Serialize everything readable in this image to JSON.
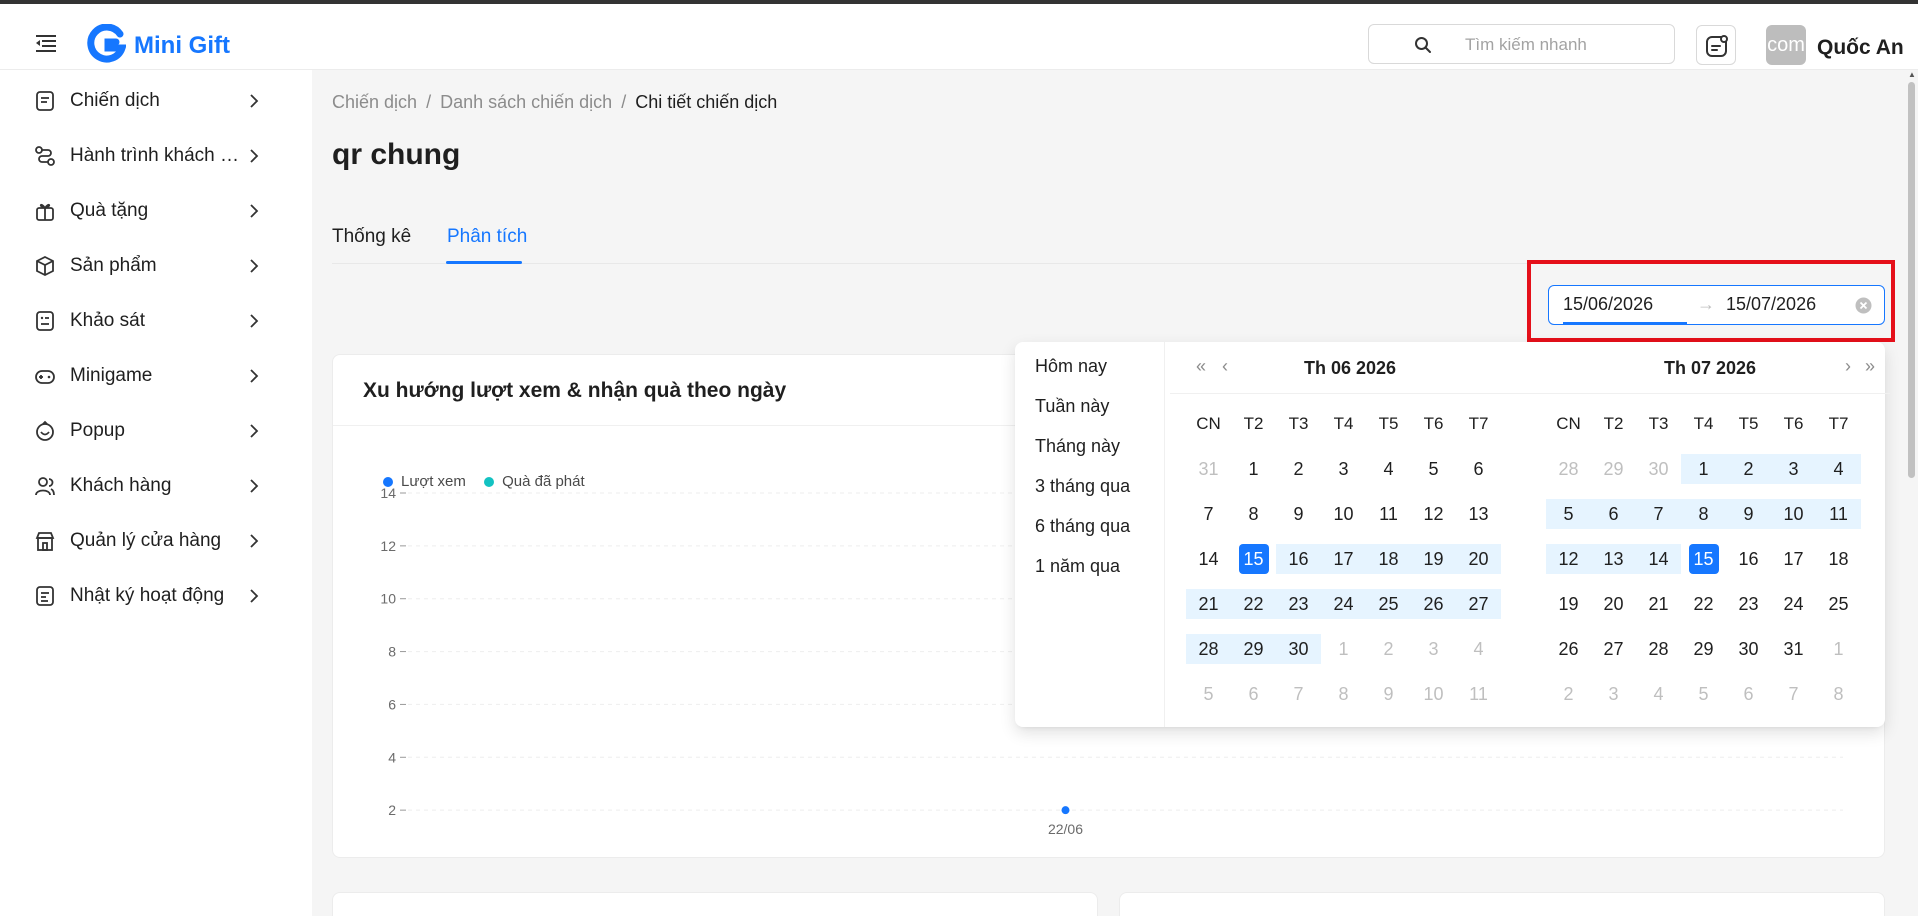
{
  "app": {
    "name": "Mini Gift",
    "brand_color": "#1677ff"
  },
  "header": {
    "search_placeholder": "Tìm kiếm nhanh",
    "avatar_text": "com",
    "user_name": "Quốc An"
  },
  "sidebar": {
    "items": [
      {
        "label": "Chiến dịch",
        "icon": "campaign-icon"
      },
      {
        "label": "Hành trình khách hàng",
        "icon": "journey-icon"
      },
      {
        "label": "Quà tặng",
        "icon": "gift-icon"
      },
      {
        "label": "Sản phẩm",
        "icon": "product-box-icon"
      },
      {
        "label": "Khảo sát",
        "icon": "survey-icon"
      },
      {
        "label": "Minigame",
        "icon": "gamepad-icon"
      },
      {
        "label": "Popup",
        "icon": "popup-icon"
      },
      {
        "label": "Khách hàng",
        "icon": "customers-icon"
      },
      {
        "label": "Quản lý cửa hàng",
        "icon": "store-icon"
      },
      {
        "label": "Nhật ký hoạt động",
        "icon": "activity-log-icon"
      }
    ]
  },
  "breadcrumb": {
    "items": [
      "Chiến dịch",
      "Danh sách chiến dịch",
      "Chi tiết chiến dịch"
    ],
    "separator": "/"
  },
  "page": {
    "title": "qr chung"
  },
  "tabs": [
    {
      "label": "Thống kê",
      "active": false
    },
    {
      "label": "Phân tích",
      "active": true
    }
  ],
  "range_picker": {
    "start": "15/06/2026",
    "end": "15/07/2026",
    "separator": "→"
  },
  "chart_card": {
    "title": "Xu hướng lượt xem & nhận quà theo ngày"
  },
  "chart_data": {
    "type": "line",
    "title": "",
    "xlabel": "",
    "ylabel": "",
    "ylim": [
      0,
      14
    ],
    "yticks": [
      14,
      12,
      10,
      8,
      6,
      4,
      2
    ],
    "x": [
      "22/06"
    ],
    "series": [
      {
        "name": "Lượt xem",
        "color": "#1677ff",
        "values": [
          2
        ]
      },
      {
        "name": "Quà đã phát",
        "color": "#13c2c2",
        "values": []
      }
    ],
    "grid": true,
    "legend": "top-left"
  },
  "date_popup": {
    "presets": [
      "Hôm nay",
      "Tuần này",
      "Tháng này",
      "3 tháng qua",
      "6 tháng qua",
      "1 năm qua"
    ],
    "weekdays": [
      "CN",
      "T2",
      "T3",
      "T4",
      "T5",
      "T6",
      "T7"
    ],
    "months": [
      {
        "title": "Th 06  2026",
        "rows": [
          [
            "31",
            "1",
            "2",
            "3",
            "4",
            "5",
            "6"
          ],
          [
            "7",
            "8",
            "9",
            "10",
            "11",
            "12",
            "13"
          ],
          [
            "14",
            "15",
            "16",
            "17",
            "18",
            "19",
            "20"
          ],
          [
            "21",
            "22",
            "23",
            "24",
            "25",
            "26",
            "27"
          ],
          [
            "28",
            "29",
            "30",
            "1",
            "2",
            "3",
            "4"
          ],
          [
            "5",
            "6",
            "7",
            "8",
            "9",
            "10",
            "11"
          ]
        ],
        "muted": [
          [
            0,
            0
          ],
          [
            4,
            3
          ],
          [
            4,
            4
          ],
          [
            4,
            5
          ],
          [
            4,
            6
          ],
          [
            5,
            0
          ],
          [
            5,
            1
          ],
          [
            5,
            2
          ],
          [
            5,
            3
          ],
          [
            5,
            4
          ],
          [
            5,
            5
          ],
          [
            5,
            6
          ]
        ],
        "selected": [
          [
            2,
            1
          ]
        ],
        "in_range": [
          [
            2,
            2
          ],
          [
            2,
            3
          ],
          [
            2,
            4
          ],
          [
            2,
            5
          ],
          [
            2,
            6
          ],
          [
            3,
            0
          ],
          [
            3,
            1
          ],
          [
            3,
            2
          ],
          [
            3,
            3
          ],
          [
            3,
            4
          ],
          [
            3,
            5
          ],
          [
            3,
            6
          ],
          [
            4,
            0
          ],
          [
            4,
            1
          ],
          [
            4,
            2
          ]
        ]
      },
      {
        "title": "Th 07  2026",
        "rows": [
          [
            "28",
            "29",
            "30",
            "1",
            "2",
            "3",
            "4"
          ],
          [
            "5",
            "6",
            "7",
            "8",
            "9",
            "10",
            "11"
          ],
          [
            "12",
            "13",
            "14",
            "15",
            "16",
            "17",
            "18"
          ],
          [
            "19",
            "20",
            "21",
            "22",
            "23",
            "24",
            "25"
          ],
          [
            "26",
            "27",
            "28",
            "29",
            "30",
            "31",
            "1"
          ],
          [
            "2",
            "3",
            "4",
            "5",
            "6",
            "7",
            "8"
          ]
        ],
        "muted": [
          [
            0,
            0
          ],
          [
            0,
            1
          ],
          [
            0,
            2
          ],
          [
            4,
            6
          ],
          [
            5,
            0
          ],
          [
            5,
            1
          ],
          [
            5,
            2
          ],
          [
            5,
            3
          ],
          [
            5,
            4
          ],
          [
            5,
            5
          ],
          [
            5,
            6
          ]
        ],
        "selected": [
          [
            2,
            3
          ]
        ],
        "in_range": [
          [
            0,
            3
          ],
          [
            0,
            4
          ],
          [
            0,
            5
          ],
          [
            0,
            6
          ],
          [
            1,
            0
          ],
          [
            1,
            1
          ],
          [
            1,
            2
          ],
          [
            1,
            3
          ],
          [
            1,
            4
          ],
          [
            1,
            5
          ],
          [
            1,
            6
          ],
          [
            2,
            0
          ],
          [
            2,
            1
          ],
          [
            2,
            2
          ]
        ]
      }
    ]
  }
}
